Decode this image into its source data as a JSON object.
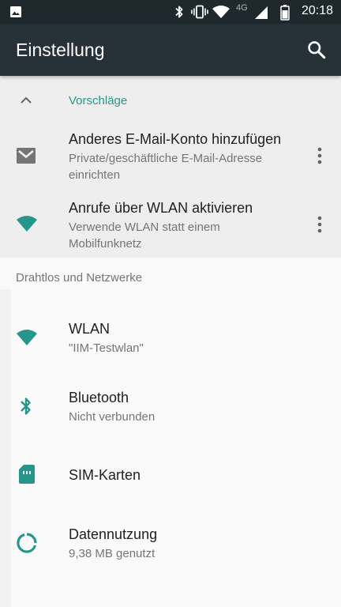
{
  "status_bar": {
    "time": "20:18",
    "network_label": "4G",
    "icons": [
      "image-icon",
      "bluetooth-icon",
      "vibrate-icon",
      "wifi-icon",
      "cellular-icon",
      "battery-icon"
    ]
  },
  "app_bar": {
    "title": "Einstellung",
    "search_icon": "search-icon"
  },
  "suggestions": {
    "header": "Vorschläge",
    "items": [
      {
        "icon": "email-icon",
        "title": "Anderes E-Mail-Konto hinzufügen",
        "subtitle": "Private/geschäftliche E-Mail-Adresse einrichten"
      },
      {
        "icon": "wifi-icon",
        "title": "Anrufe über WLAN aktivieren",
        "subtitle": "Verwende WLAN statt einem Mobilfunknetz"
      }
    ]
  },
  "wireless": {
    "header": "Drahtlos und Netzwerke",
    "items": [
      {
        "icon": "wifi-icon",
        "title": "WLAN",
        "subtitle": "\"IIM-Testwlan\""
      },
      {
        "icon": "bluetooth-icon",
        "title": "Bluetooth",
        "subtitle": "Nicht verbunden"
      },
      {
        "icon": "sim-card-icon",
        "title": "SIM-Karten"
      },
      {
        "icon": "data-usage-icon",
        "title": "Datennutzung",
        "subtitle": "9,38 MB genutzt"
      }
    ]
  },
  "colors": {
    "app_bar": "#263238",
    "status_bar": "#1f282c",
    "accent": "#26968a",
    "suggestion_bg": "#eeeeee",
    "page_bg": "#fafafa"
  }
}
